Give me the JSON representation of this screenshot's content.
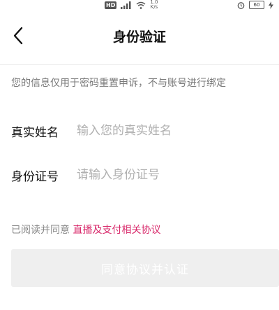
{
  "status_bar": {
    "hd_badge": "HD",
    "speed_value": "1.0",
    "speed_unit": "K/s",
    "battery": "60"
  },
  "header": {
    "title": "身份验证",
    "back_icon": "chevron-left-icon"
  },
  "notice": "您的信息仅用于密码重置申诉，不与账号进行绑定",
  "form": {
    "name": {
      "label": "真实姓名",
      "placeholder": "输入您的真实姓名",
      "value": ""
    },
    "id_number": {
      "label": "身份证号",
      "placeholder": "请输入身份证号",
      "value": ""
    }
  },
  "agreement": {
    "prefix": "已阅读并同意",
    "link_text": "直播及支付相关协议"
  },
  "submit_label": "同意协议并认证",
  "colors": {
    "accent_link": "#d8286a",
    "button_disabled_bg": "#efefef",
    "placeholder": "#b0b0b0"
  }
}
